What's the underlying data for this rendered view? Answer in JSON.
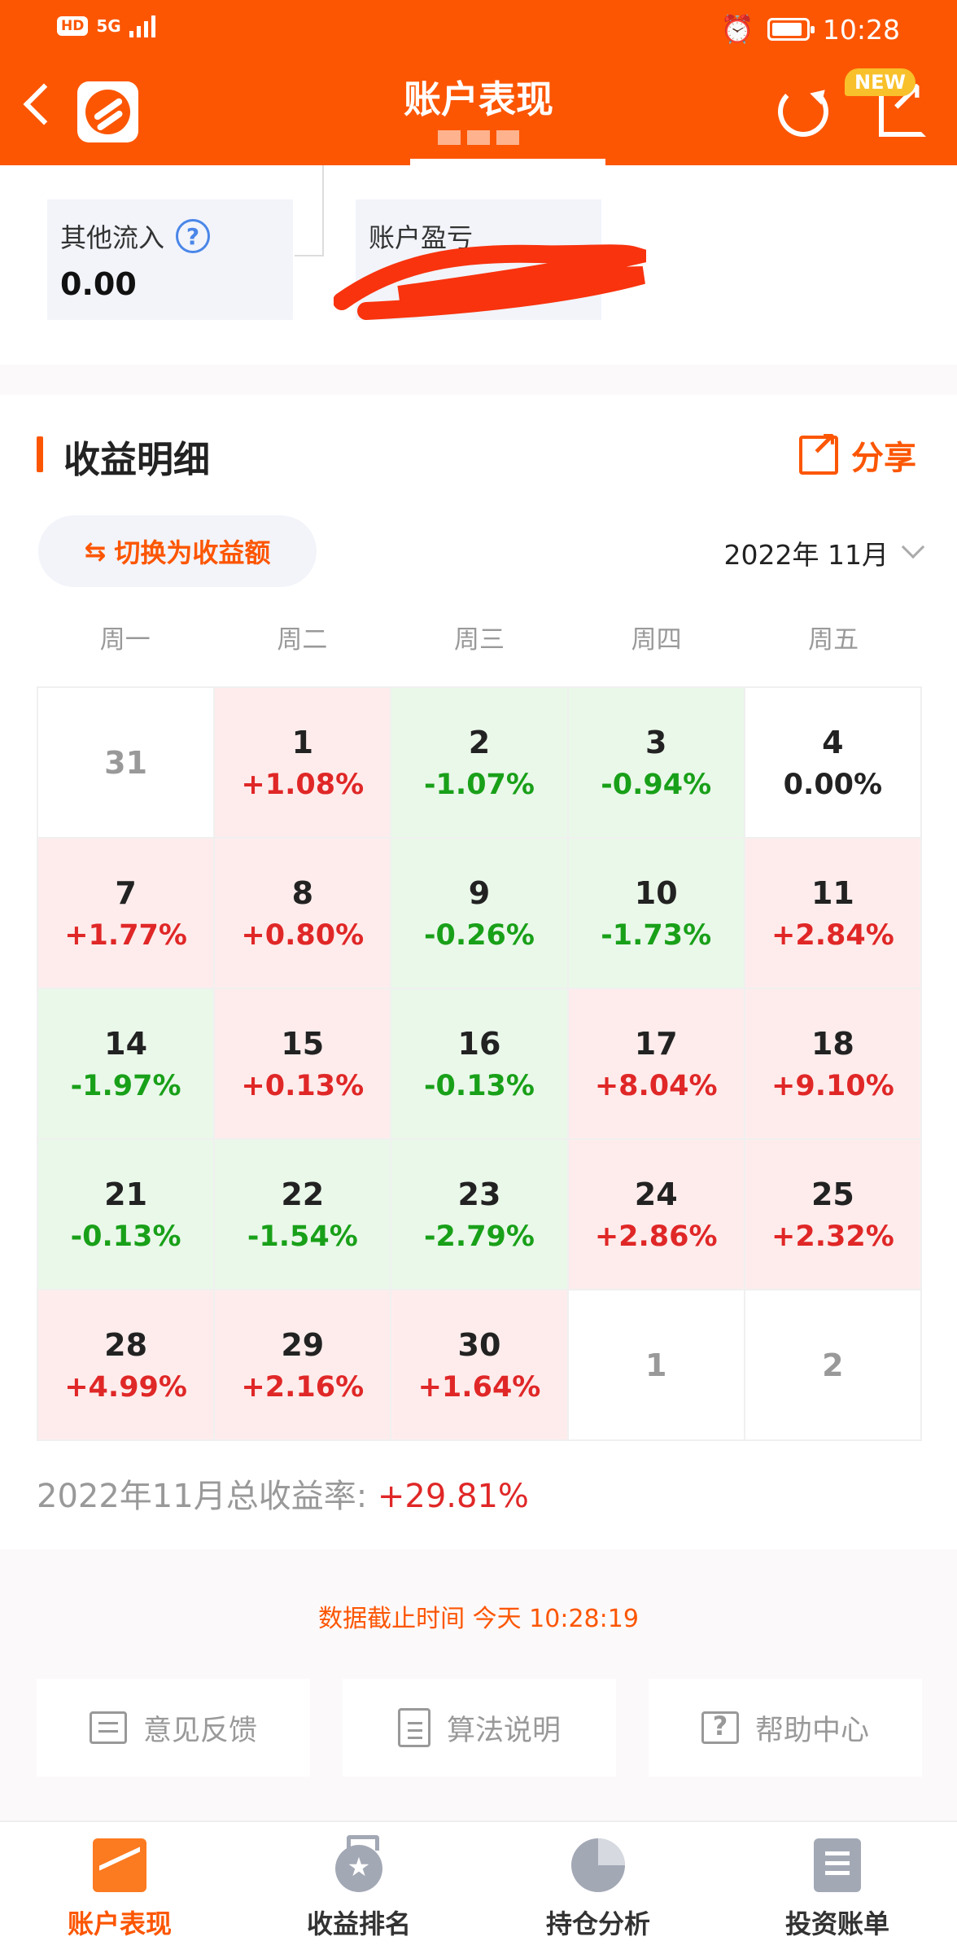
{
  "status_bar": {
    "hd": "HD",
    "network": "5G",
    "time": "10:28"
  },
  "header": {
    "title": "账户表现",
    "new_badge": "NEW",
    "bg_color": "#fc5603"
  },
  "summary": {
    "other_inflow": {
      "label": "其他流入",
      "value": "0.00"
    },
    "account_pnl": {
      "label": "账户盈亏"
    }
  },
  "section": {
    "title": "收益明细",
    "share_label": "分享",
    "switch_label": "切换为收益额",
    "month": "2022年 11月"
  },
  "weekdays": [
    "周一",
    "周二",
    "周三",
    "周四",
    "周五"
  ],
  "calendar": [
    {
      "day": "31",
      "pct": "",
      "status": "other"
    },
    {
      "day": "1",
      "pct": "+1.08%",
      "status": "up"
    },
    {
      "day": "2",
      "pct": "-1.07%",
      "status": "down"
    },
    {
      "day": "3",
      "pct": "-0.94%",
      "status": "down"
    },
    {
      "day": "4",
      "pct": "0.00%",
      "status": "zero"
    },
    {
      "day": "7",
      "pct": "+1.77%",
      "status": "up"
    },
    {
      "day": "8",
      "pct": "+0.80%",
      "status": "up"
    },
    {
      "day": "9",
      "pct": "-0.26%",
      "status": "down"
    },
    {
      "day": "10",
      "pct": "-1.73%",
      "status": "down"
    },
    {
      "day": "11",
      "pct": "+2.84%",
      "status": "up"
    },
    {
      "day": "14",
      "pct": "-1.97%",
      "status": "down"
    },
    {
      "day": "15",
      "pct": "+0.13%",
      "status": "up"
    },
    {
      "day": "16",
      "pct": "-0.13%",
      "status": "down"
    },
    {
      "day": "17",
      "pct": "+8.04%",
      "status": "up"
    },
    {
      "day": "18",
      "pct": "+9.10%",
      "status": "up"
    },
    {
      "day": "21",
      "pct": "-0.13%",
      "status": "down"
    },
    {
      "day": "22",
      "pct": "-1.54%",
      "status": "down"
    },
    {
      "day": "23",
      "pct": "-2.79%",
      "status": "down"
    },
    {
      "day": "24",
      "pct": "+2.86%",
      "status": "up"
    },
    {
      "day": "25",
      "pct": "+2.32%",
      "status": "up"
    },
    {
      "day": "28",
      "pct": "+4.99%",
      "status": "up"
    },
    {
      "day": "29",
      "pct": "+2.16%",
      "status": "up"
    },
    {
      "day": "30",
      "pct": "+1.64%",
      "status": "up"
    },
    {
      "day": "1",
      "pct": "",
      "status": "other"
    },
    {
      "day": "2",
      "pct": "",
      "status": "other"
    }
  ],
  "total": {
    "label": "2022年11月总收益率:",
    "value": "+29.81%"
  },
  "as_of": "数据截止时间 今天 10:28:19",
  "links": [
    {
      "label": "意见反馈",
      "icon": "feedback-icon"
    },
    {
      "label": "算法说明",
      "icon": "clipboard-icon"
    },
    {
      "label": "帮助中心",
      "icon": "help-icon"
    }
  ],
  "nav": [
    {
      "label": "账户表现",
      "icon": "chart-icon",
      "active": true
    },
    {
      "label": "收益排名",
      "icon": "medal-icon",
      "active": false
    },
    {
      "label": "持仓分析",
      "icon": "pie-icon",
      "active": false
    },
    {
      "label": "投资账单",
      "icon": "bill-icon",
      "active": false
    }
  ],
  "colors": {
    "accent": "#fc5603",
    "up": "#e02727",
    "down": "#19a019",
    "up_bg": "#feecec",
    "down_bg": "#eaf8ea"
  }
}
